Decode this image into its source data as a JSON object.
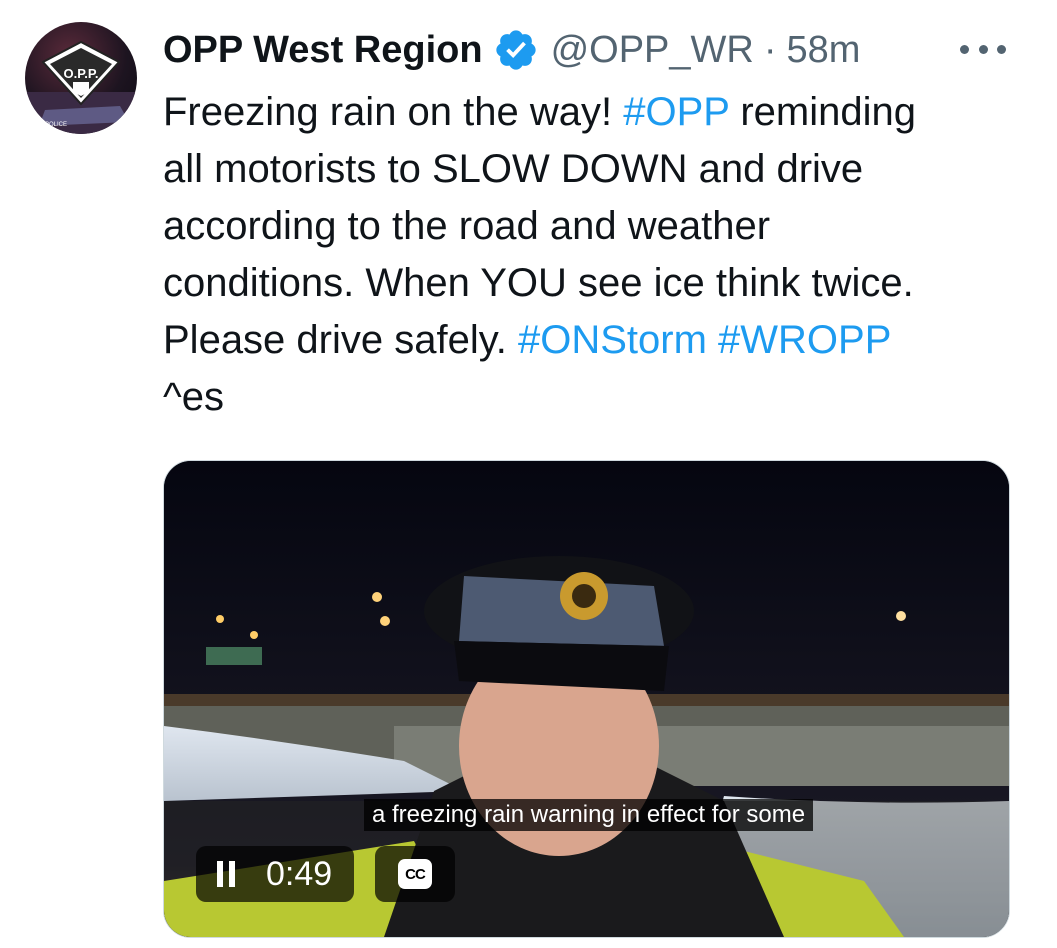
{
  "tweet": {
    "avatar_icon": "opp-logo-avatar",
    "avatar_text": {
      "logo": "O.P.P.",
      "car_text": "POLICE"
    },
    "display_name": "OPP West Region",
    "verified_icon": "verified-badge-icon",
    "handle": "@OPP_WR",
    "separator": "·",
    "timestamp": "58m",
    "more_icon": "more-dots-icon",
    "text": {
      "l1_a": "Freezing rain on the way! ",
      "l1_tag": "#OPP",
      "l1_b": " reminding",
      "l2": "all motorists to SLOW DOWN and drive",
      "l3": "according to the road and weather",
      "l4": "conditions. When YOU see ice think twice.",
      "l5_a": "Please drive safely. ",
      "l5_tag1": "#ONStorm",
      "l5_space": " ",
      "l5_tag2": "#WROPP",
      "l6": "^es"
    }
  },
  "video": {
    "caption": "a freezing rain warning in effect for some",
    "elapsed": "0:49",
    "pause_icon": "pause-icon",
    "cc_label": "CC",
    "cc_icon": "closed-captions-icon"
  },
  "colors": {
    "link": "#1d9bf0",
    "verified": "#1d9bf0",
    "text": "#0f1419",
    "secondary": "#536471"
  }
}
